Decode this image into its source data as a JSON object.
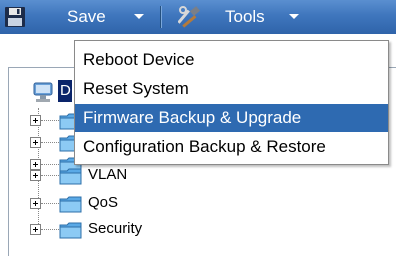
{
  "toolbar": {
    "save_label": "Save",
    "tools_label": "Tools"
  },
  "menu": {
    "items": [
      {
        "label": "Reboot Device"
      },
      {
        "label": "Reset System"
      },
      {
        "label": "Firmware Backup & Upgrade",
        "highlighted": true
      },
      {
        "label": "Configuration Backup & Restore"
      }
    ]
  },
  "tree": {
    "root_label": "D",
    "items": [
      {
        "label": ""
      },
      {
        "label": ""
      },
      {
        "label": ""
      },
      {
        "label": "VLAN"
      },
      {
        "label": "QoS"
      },
      {
        "label": "Security"
      }
    ]
  },
  "colors": {
    "toolbar_blue": "#3f76bd",
    "menu_highlight": "#2e6ab1",
    "root_selection": "#0a246a"
  },
  "icons": {
    "save": "floppy-disk-icon",
    "tools": "hammer-wrench-icon",
    "caret": "caret-down-icon",
    "tree_expand": "plus-box-icon",
    "folder": "folder-icon",
    "root": "network-device-icon"
  }
}
